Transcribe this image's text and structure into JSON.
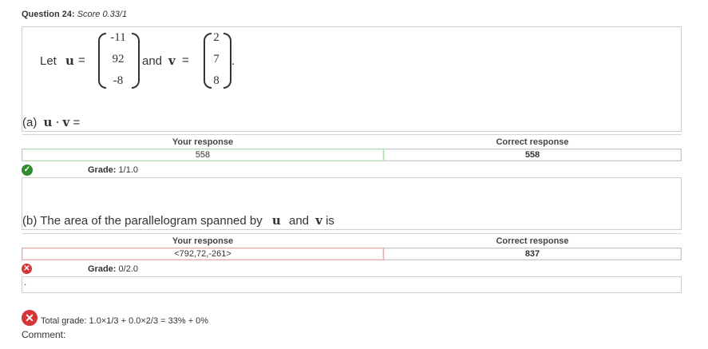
{
  "question": {
    "label": "Question 24:",
    "score": "Score 0.33/1"
  },
  "statement": {
    "let": "Let",
    "u_sym": "u",
    "eq": "=",
    "and": "and",
    "v_sym": "v",
    "period": ".",
    "u_vec": [
      "-11",
      "92",
      "-8"
    ],
    "v_vec": [
      "2",
      "7",
      "8"
    ]
  },
  "part_a": {
    "prefix": "(a)",
    "u": "u",
    "dot": "·",
    "v": "v",
    "eq": "=",
    "your_response_header": "Your response",
    "correct_response_header": "Correct response",
    "your_response": "558",
    "correct_response": "558",
    "grade_label": "Grade:",
    "grade_value": "1/1.0"
  },
  "part_b": {
    "prefix": "(b) The area of the parallelogram spanned by",
    "u": "u",
    "and": "and",
    "v": "v",
    "suffix": "is",
    "your_response_header": "Your response",
    "correct_response_header": "Correct response",
    "your_response": "<792,72,-261>",
    "correct_response": "837",
    "grade_label": "Grade:",
    "grade_value": "0/2.0",
    "note": "."
  },
  "total": {
    "text": "Total grade: 1.0×1/3 + 0.0×2/3 = 33% + 0%"
  },
  "comment": {
    "label": "Comment:"
  },
  "colors": {
    "ok": "#2e8b2e",
    "bad": "#d73535"
  }
}
